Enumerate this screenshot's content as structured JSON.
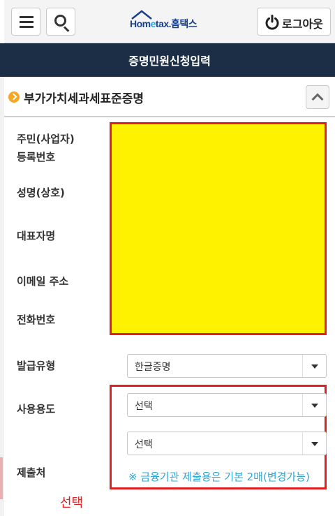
{
  "header": {
    "menu_icon": "hamburger-menu-icon",
    "search_icon": "search-icon",
    "logo_text_home": "Hom",
    "logo_text_e": "e",
    "logo_text_rest": "tax.홈택스",
    "logout_label": "로그아웃",
    "logout_icon": "power-icon"
  },
  "title_bar": {
    "title": "증명민원신청입력"
  },
  "section": {
    "title": "부가가치세과세표준증명",
    "collapse_icon": "chevron-up-icon"
  },
  "form": {
    "labels": {
      "resident_number_line1": "주민(사업자)",
      "resident_number_line2": "등록번호",
      "name": "성명(상호)",
      "representative": "대표자명",
      "email": "이메일 주소",
      "phone": "전화번호",
      "issue_type": "발급유형",
      "usage": "사용용도",
      "submit_to": "제출처"
    },
    "issue_type_value": "한글증명",
    "usage_value": "선택",
    "submit_to_value": "선택",
    "notice_text": "※ 금융기관 제출용은 기본 2매(변경가능)"
  },
  "annotation": {
    "text": "선택"
  },
  "colors": {
    "title_bar_bg": "#1c2e46",
    "redaction": "#fff200",
    "highlight_border": "#e02020",
    "notice": "#2aa7d6"
  }
}
